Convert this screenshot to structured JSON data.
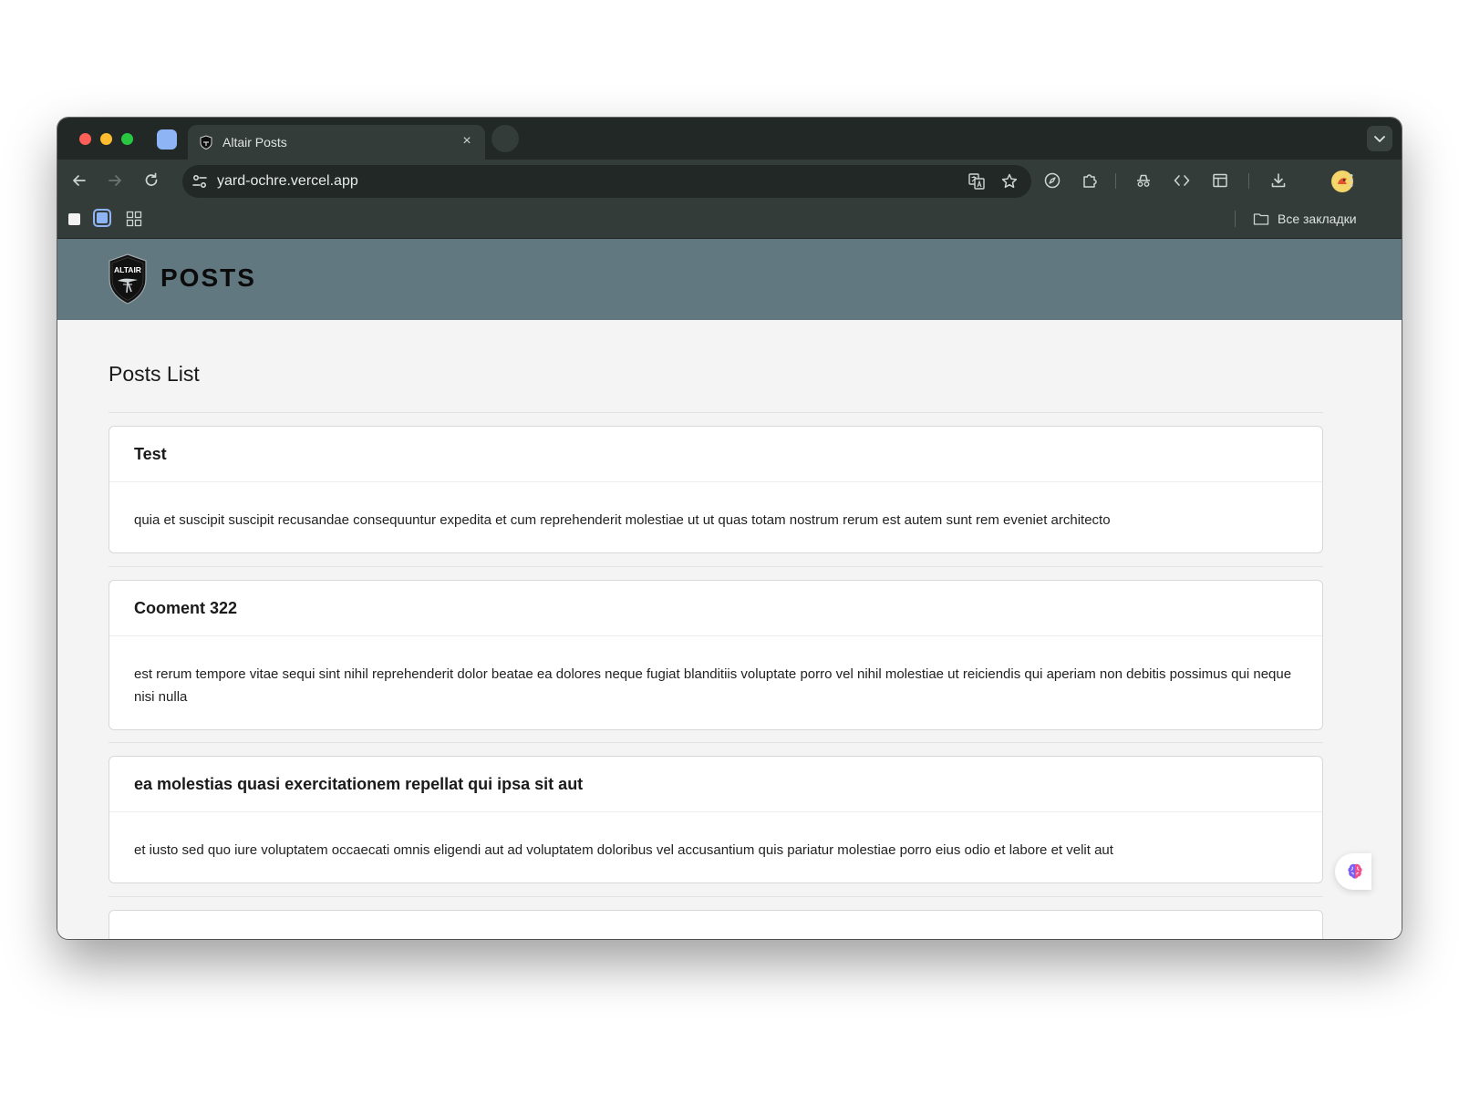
{
  "browser": {
    "tab_title": "Altair Posts",
    "tab_close_icon": "×",
    "url": "yard-ochre.vercel.app",
    "bookmarks_all_label": "Все закладки",
    "icons": [
      "back-icon",
      "forward-icon",
      "reload-icon",
      "tune-icon",
      "translate-icon",
      "star-icon",
      "compass-icon",
      "extensions-icon",
      "incognito-icon",
      "code-icon",
      "side-panel-icon",
      "download-icon",
      "more-icon",
      "apps-grid-icon",
      "folder-icon"
    ]
  },
  "header": {
    "logo_text": "ALTAIR",
    "brand": "POSTS",
    "color": "#627880"
  },
  "main": {
    "title": "Posts List",
    "posts": [
      {
        "title": "Test",
        "body": "quia et suscipit suscipit recusandae consequuntur expedita et cum reprehenderit molestiae ut ut quas totam nostrum rerum est autem sunt rem eveniet architecto"
      },
      {
        "title": "Cooment 322",
        "body": "est rerum tempore vitae sequi sint nihil reprehenderit dolor beatae ea dolores neque fugiat blanditiis voluptate porro vel nihil molestiae ut reiciendis qui aperiam non debitis possimus qui neque nisi nulla"
      },
      {
        "title": "ea molestias quasi exercitationem repellat qui ipsa sit aut",
        "body": "et iusto sed quo iure voluptatem occaecati omnis eligendi aut ad voluptatem doloribus vel accusantium quis pariatur molestiae porro eius odio et labore et velit aut"
      }
    ]
  }
}
